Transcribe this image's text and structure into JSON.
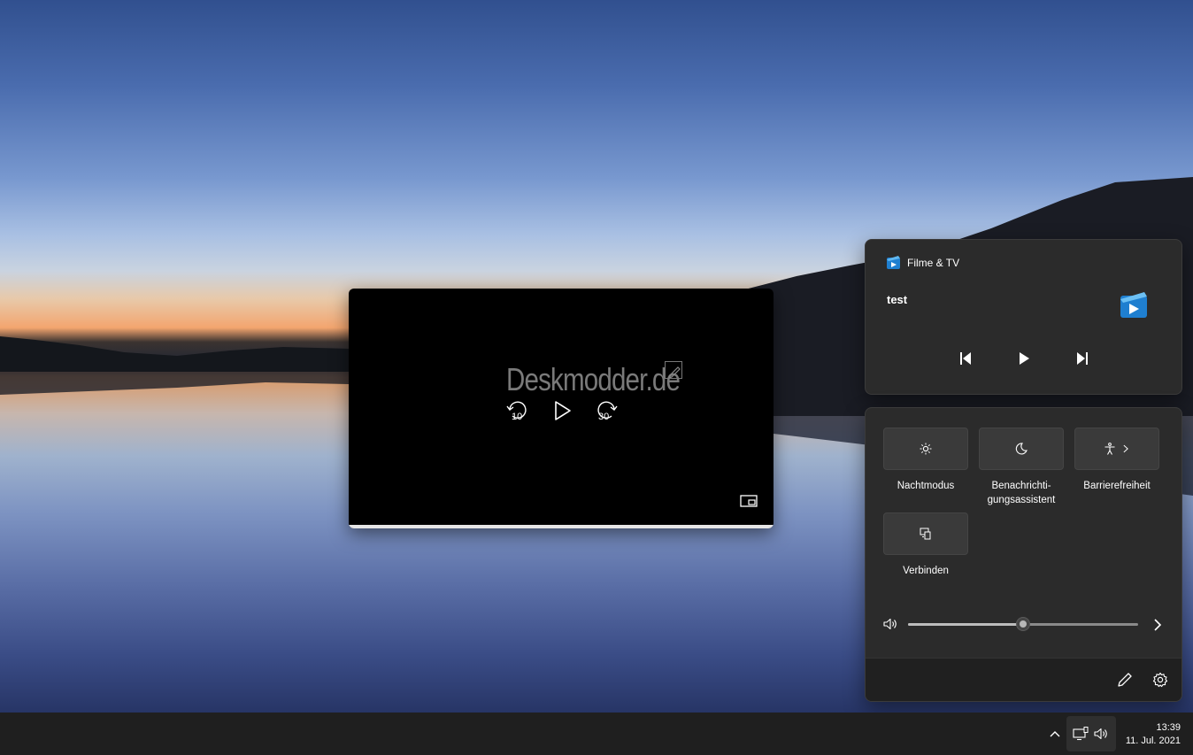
{
  "player": {
    "watermark": "Deskmodder.de",
    "skip_back": "10",
    "skip_forward": "30"
  },
  "media": {
    "app_name": "Filme & TV",
    "track_title": "test"
  },
  "quick_settings": {
    "tiles": [
      {
        "label": "Nachtmodus",
        "icon": "brightness-icon"
      },
      {
        "label": "Benachrichti-\ngungsassistent",
        "icon": "moon-icon"
      },
      {
        "label": "Barrierefreiheit",
        "icon": "accessibility-icon"
      },
      {
        "label": "Verbinden",
        "icon": "cast-icon"
      }
    ],
    "volume_level": 0.5
  },
  "taskbar": {
    "time": "13:39",
    "date": "11. Jul. 2021"
  },
  "colors": {
    "panel_bg": "#2b2b2b",
    "tile_bg": "#3a3a3a",
    "taskbar_bg": "#1f1f1f",
    "accent": "#2b8fd8"
  }
}
